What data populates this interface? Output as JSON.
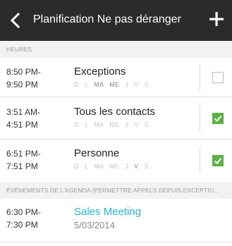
{
  "header": {
    "title": "Planification Ne pas déranger",
    "back_icon": "chevron-left-icon",
    "add_icon": "plus-icon",
    "background": "#2b2b2b"
  },
  "sections": {
    "hours": "HEURES",
    "calendar": "ÉVÉNEMENTS DE L'AGENDA (PERMETTRE APPELS DEPUIS EXCEPTIO..."
  },
  "rules": [
    {
      "start": "8:50 PM-",
      "end": "9:50 PM",
      "name": "Exceptions",
      "days": [
        "D",
        "L",
        "MA",
        "ME",
        "J",
        "V",
        "S"
      ],
      "active_days": [
        "MA",
        "ME"
      ],
      "checked": false
    },
    {
      "start": "3:51 AM-",
      "end": "4:51 PM",
      "name": "Tous les contacts",
      "days": [
        "D",
        "L",
        "MA",
        "ME",
        "J",
        "V",
        "S"
      ],
      "active_days": [],
      "checked": true
    },
    {
      "start": "6:51 PM-",
      "end": "7:51 PM",
      "name": "Personne",
      "days": [
        "D",
        "L",
        "MA",
        "ME",
        "J",
        "V",
        "S"
      ],
      "active_days": [
        "V"
      ],
      "checked": true
    }
  ],
  "events": [
    {
      "start": "6:30 PM-",
      "end": "7:30 PM",
      "name": "Sales Meeting",
      "date": "5/03/2014"
    }
  ],
  "colors": {
    "checkbox_checked": "#5cb247",
    "event_accent": "#2ab5d6"
  }
}
